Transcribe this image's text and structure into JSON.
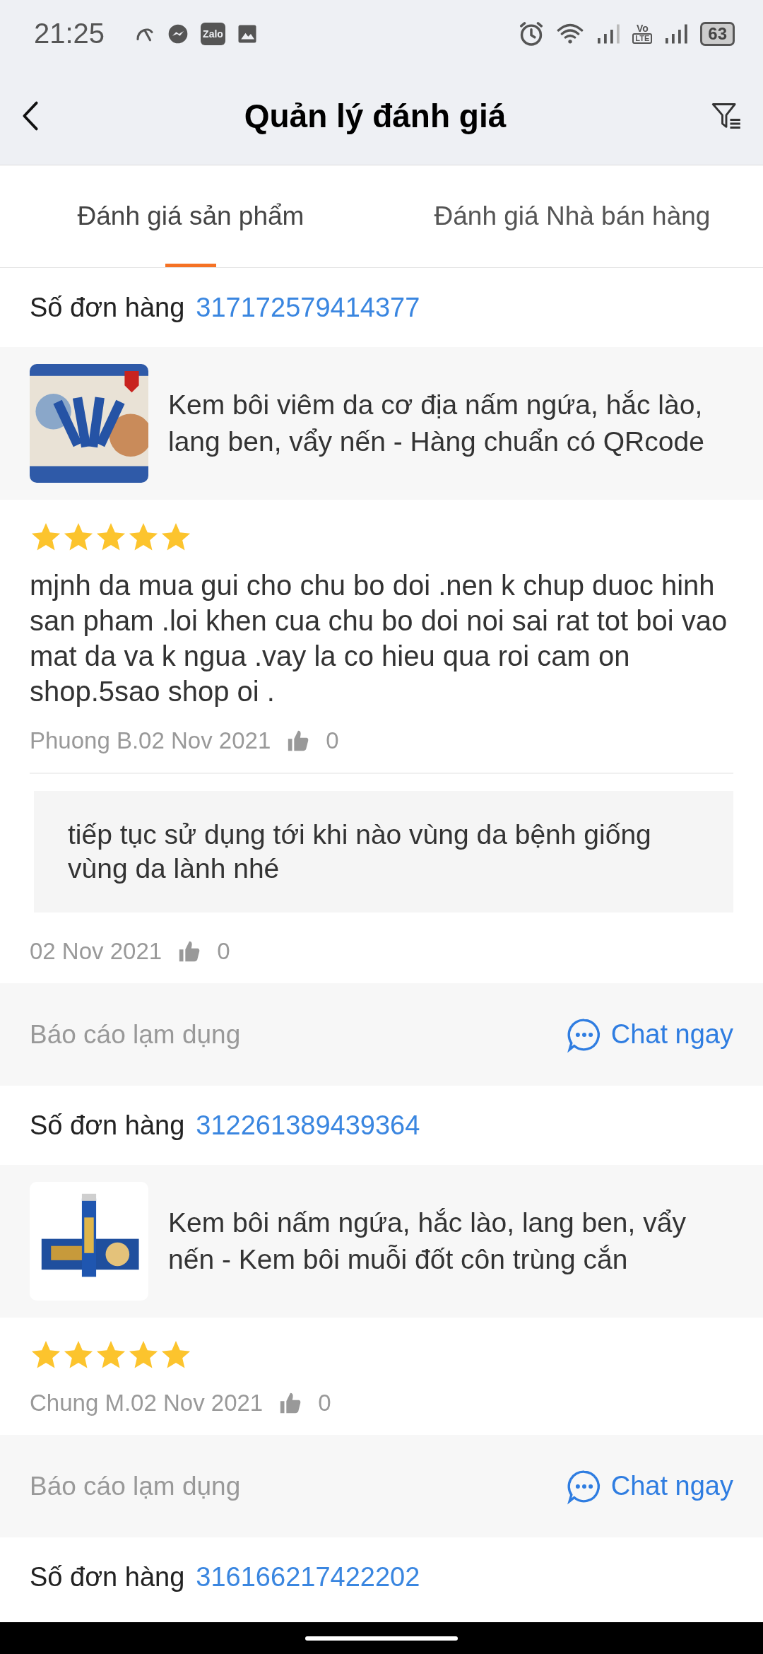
{
  "status_bar": {
    "time": "21:25",
    "zalo": "Zalo",
    "volte_top": "Vo",
    "volte_bottom": "LTE",
    "battery": "63"
  },
  "header": {
    "title": "Quản lý đánh giá"
  },
  "tabs": [
    {
      "label": "Đánh giá sản phẩm",
      "selected": true
    },
    {
      "label": "Đánh giá Nhà bán hàng",
      "selected": false
    }
  ],
  "reviews": [
    {
      "order_label": "Số đơn hàng",
      "order_number": "317172579414377",
      "product_name": "Kem bôi viêm da cơ địa nấm ngứa, hắc lào, lang ben, vẩy nến - Hàng chuẩn có QRcode",
      "stars": 5,
      "text": "mjnh da mua gui cho chu bo doi .nen k chup duoc hinh san pham .loi khen cua chu bo doi noi sai rat tot boi vao mat da va k ngua .vay la co hieu qua roi cam on shop.5sao shop oi .",
      "author_date": "Phuong B.02 Nov 2021",
      "likes": "0",
      "seller_reply": {
        "text": "tiếp tục sử dụng tới khi nào vùng da bệnh giống vùng da lành nhé",
        "date": "02 Nov 2021",
        "likes": "0"
      },
      "report": "Báo cáo lạm dụng",
      "chat": "Chat ngay"
    },
    {
      "order_label": "Số đơn hàng",
      "order_number": "312261389439364",
      "product_name": "Kem bôi nấm ngứa, hắc lào, lang ben, vẩy nến - Kem bôi muỗi đốt côn trùng cắn",
      "stars": 5,
      "author_date": "Chung M.02 Nov 2021",
      "likes": "0",
      "report": "Báo cáo lạm dụng",
      "chat": "Chat ngay"
    },
    {
      "order_label": "Số đơn hàng",
      "order_number": "316166217422202"
    }
  ]
}
